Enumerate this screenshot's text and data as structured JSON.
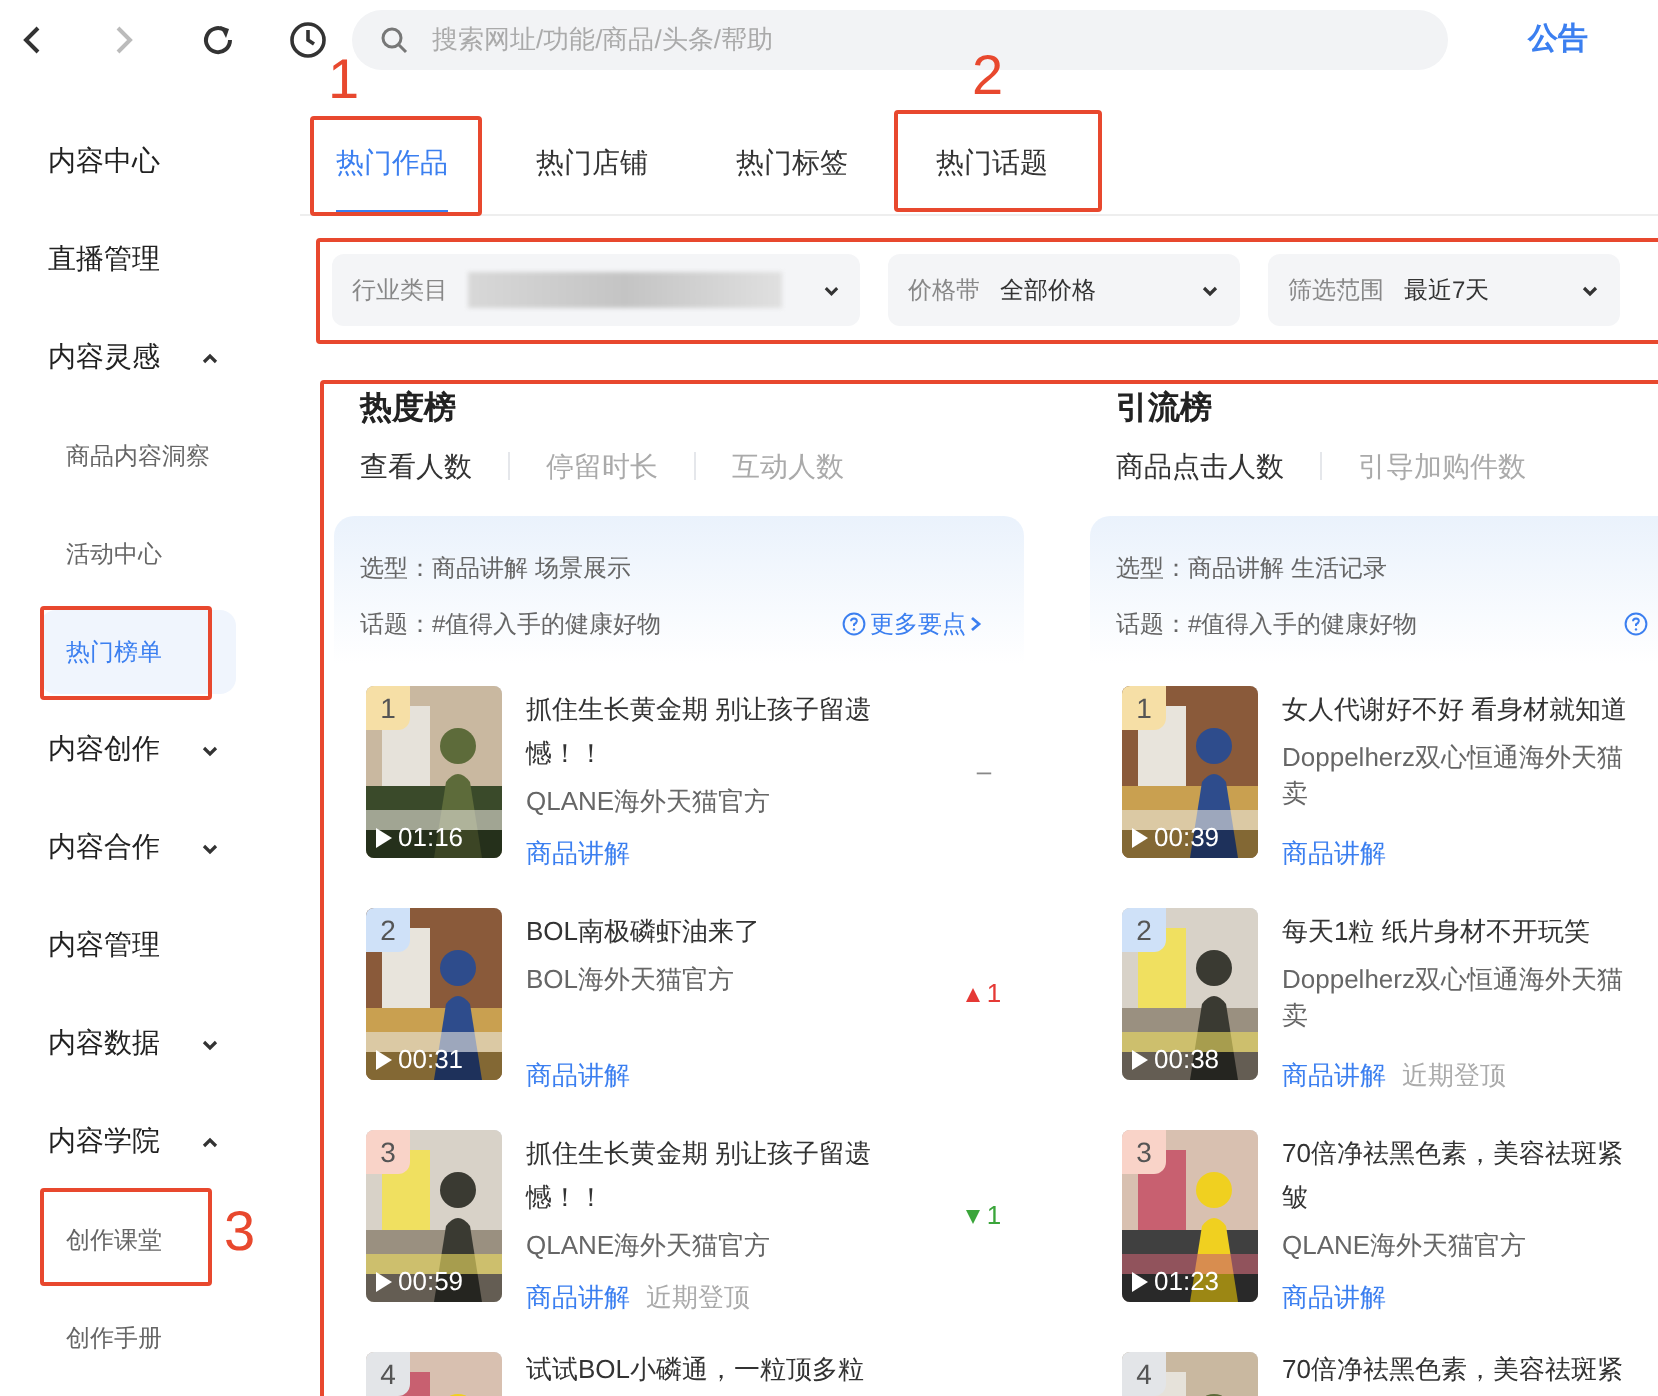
{
  "toolbar": {
    "search": {
      "placeholder": "搜索网址/功能/商品/头条/帮助"
    },
    "notice": "公告"
  },
  "sidebar": {
    "items": [
      {
        "label": "内容中心",
        "selected": false
      },
      {
        "label": "直播管理",
        "selected": false
      },
      {
        "label": "内容灵感",
        "selected": false,
        "expanded": true,
        "children": [
          {
            "label": "商品内容洞察",
            "selected": false
          },
          {
            "label": "活动中心",
            "selected": false
          },
          {
            "label": "热门榜单",
            "selected": true
          }
        ]
      },
      {
        "label": "内容创作",
        "selected": false,
        "expanded": false
      },
      {
        "label": "内容合作",
        "selected": false,
        "expanded": false
      },
      {
        "label": "内容管理",
        "selected": false
      },
      {
        "label": "内容数据",
        "selected": false,
        "expanded": false
      },
      {
        "label": "内容学院",
        "selected": false,
        "expanded": true,
        "children": [
          {
            "label": "创作课堂",
            "selected": false
          },
          {
            "label": "创作手册",
            "selected": false
          }
        ]
      }
    ]
  },
  "tabs": [
    {
      "label": "热门作品",
      "selected": true
    },
    {
      "label": "热门店铺",
      "selected": false
    },
    {
      "label": "热门标签",
      "selected": false
    },
    {
      "label": "热门话题",
      "selected": false
    }
  ],
  "filters": [
    {
      "label": "行业类目",
      "value_blurred": true
    },
    {
      "label": "价格带",
      "value": "全部价格"
    },
    {
      "label": "筛选范围",
      "value": "最近7天"
    }
  ],
  "boards": [
    {
      "title": "热度榜",
      "metrics": [
        {
          "label": "查看人数",
          "selected": true
        },
        {
          "label": "停留时长",
          "selected": false
        },
        {
          "label": "互动人数",
          "selected": false
        }
      ],
      "type_line": "选型：商品讲解 场景展示",
      "topic_line": "话题：#值得入手的健康好物",
      "more_link": "更多要点",
      "items": [
        {
          "rank": "1",
          "color": "#f6dfa6",
          "duration": "01:16",
          "title_lines": [
            "抓住生长黄金期 别让孩子留遗",
            "憾！！"
          ],
          "shop_lines": [
            "QLANE海外天猫官方"
          ],
          "tags": [
            {
              "label": "商品讲解",
              "kind": "link"
            }
          ],
          "change": {
            "kind": "same",
            "text": "–"
          }
        },
        {
          "rank": "2",
          "color": "#cfe1f8",
          "duration": "00:31",
          "title_lines": [
            "BOL南极磷虾油来了"
          ],
          "shop_lines": [
            "BOL海外天猫官方"
          ],
          "tags": [
            {
              "label": "商品讲解",
              "kind": "link"
            }
          ],
          "change": {
            "kind": "up",
            "text": "1"
          }
        },
        {
          "rank": "3",
          "color": "#f9d3c8",
          "duration": "00:59",
          "title_lines": [
            "抓住生长黄金期 别让孩子留遗",
            "憾！！"
          ],
          "shop_lines": [
            "QLANE海外天猫官方"
          ],
          "tags": [
            {
              "label": "商品讲解",
              "kind": "link"
            },
            {
              "label": "近期登顶",
              "kind": "plain"
            }
          ],
          "change": {
            "kind": "down",
            "text": "1"
          }
        },
        {
          "rank": "4",
          "color": "#e3e5e8",
          "title_lines": [
            "试试BOL小磷通，一粒顶多粒"
          ]
        }
      ]
    },
    {
      "title": "引流榜",
      "metrics": [
        {
          "label": "商品点击人数",
          "selected": true
        },
        {
          "label": "引导加购件数",
          "selected": false
        }
      ],
      "type_line": "选型：商品讲解 生活记录",
      "topic_line": "话题：#值得入手的健康好物",
      "items": [
        {
          "rank": "1",
          "color": "#f6dfa6",
          "duration": "00:39",
          "title_lines": [
            "女人代谢好不好 看身材就知道"
          ],
          "shop_lines": [
            "Doppelherz双心恒通海外天猫",
            "卖"
          ],
          "tags": [
            {
              "label": "商品讲解",
              "kind": "link"
            }
          ]
        },
        {
          "rank": "2",
          "color": "#cfe1f8",
          "duration": "00:38",
          "title_lines": [
            "每天1粒 纸片身材不开玩笑"
          ],
          "shop_lines": [
            "Doppelherz双心恒通海外天猫",
            "卖"
          ],
          "tags": [
            {
              "label": "商品讲解",
              "kind": "link"
            },
            {
              "label": "近期登顶",
              "kind": "plain"
            }
          ]
        },
        {
          "rank": "3",
          "color": "#f9d3c8",
          "duration": "01:23",
          "title_lines": [
            "70倍净祛黑色素，美容祛斑紧",
            "皱"
          ],
          "shop_lines": [
            "QLANE海外天猫官方"
          ],
          "tags": [
            {
              "label": "商品讲解",
              "kind": "link"
            }
          ]
        },
        {
          "rank": "4",
          "color": "#e3e5e8",
          "title_lines": [
            "70倍净祛黑色素，美容祛斑紧"
          ]
        }
      ]
    }
  ],
  "annotations": [
    {
      "kind": "number",
      "text": "1"
    },
    {
      "kind": "number",
      "text": "2"
    },
    {
      "kind": "number",
      "text": "3"
    }
  ]
}
